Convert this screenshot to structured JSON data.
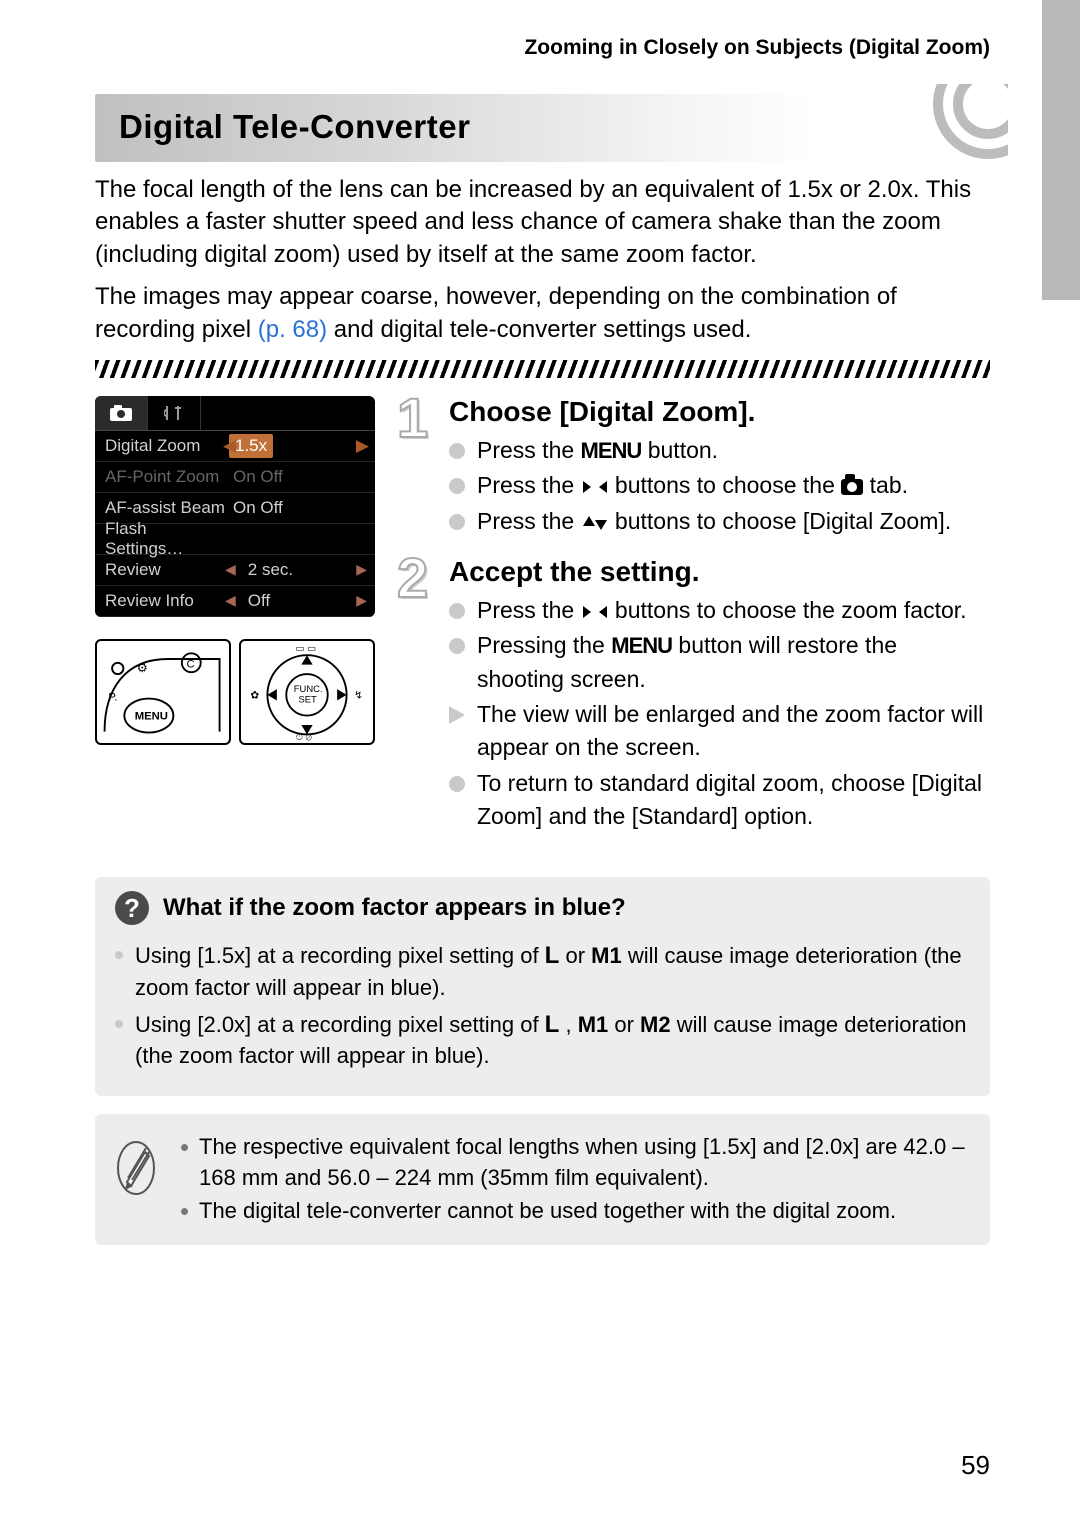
{
  "header": "Zooming in Closely on Subjects (Digital Zoom)",
  "section_title": "Digital Tele-Converter",
  "intro_1": "The focal length of the lens can be increased by an equivalent of 1.5x or 2.0x. This enables a faster shutter speed and less chance of camera shake than the zoom (including digital zoom) used by itself at the same zoom factor.",
  "intro_2a": "The images may appear coarse, however, depending on the combination of recording pixel ",
  "intro_2_link": "(p. 68)",
  "intro_2b": " and digital tele-converter settings used.",
  "menu": {
    "rows": [
      {
        "label": "Digital Zoom",
        "value": "1.5x",
        "selected": true
      },
      {
        "label": "AF-Point Zoom",
        "value": "On   Off",
        "dim": true
      },
      {
        "label": "AF-assist Beam",
        "value": "On   Off"
      },
      {
        "label": "Flash Settings…",
        "value": ""
      },
      {
        "label": "Review",
        "value": "2 sec.",
        "carets": true
      },
      {
        "label": "Review Info",
        "value": "Off",
        "carets": true
      }
    ]
  },
  "steps": [
    {
      "num": "1",
      "title": "Choose [Digital Zoom].",
      "items": [
        {
          "type": "bullet",
          "parts": [
            "Press the ",
            {
              "glyph": "MENU"
            },
            " button."
          ]
        },
        {
          "type": "bullet",
          "parts": [
            "Press the ",
            {
              "glyph": "LR"
            },
            " buttons to choose the ",
            {
              "glyph": "CAMERA"
            },
            " tab."
          ]
        },
        {
          "type": "bullet",
          "parts": [
            "Press the ",
            {
              "glyph": "UD"
            },
            " buttons to choose [Digital Zoom]."
          ]
        }
      ]
    },
    {
      "num": "2",
      "title": "Accept the setting.",
      "items": [
        {
          "type": "bullet",
          "parts": [
            "Press the ",
            {
              "glyph": "LR"
            },
            " buttons to choose the zoom factor."
          ]
        },
        {
          "type": "bullet",
          "parts": [
            "Pressing the ",
            {
              "glyph": "MENU"
            },
            " button will restore the shooting screen."
          ]
        },
        {
          "type": "result",
          "parts": [
            "The view will be enlarged and the zoom factor will appear on the screen."
          ]
        },
        {
          "type": "bullet",
          "parts": [
            "To return to standard digital zoom, choose [Digital Zoom] and the [Standard] option."
          ]
        }
      ]
    }
  ],
  "qbox": {
    "title": "What if the zoom factor appears in blue?",
    "items": [
      {
        "parts": [
          "Using [1.5x] at a recording pixel setting of  ",
          {
            "glyph": "L"
          },
          "  or ",
          {
            "glyph": "M1"
          },
          " will cause image deterioration (the zoom factor will appear in blue)."
        ]
      },
      {
        "parts": [
          "Using [2.0x] at a recording pixel setting of  ",
          {
            "glyph": "L"
          },
          " , ",
          {
            "glyph": "M1"
          },
          " or ",
          {
            "glyph": "M2"
          },
          "  will cause image deterioration (the zoom factor will appear in blue)."
        ]
      }
    ]
  },
  "notes": [
    "The respective equivalent focal lengths when using [1.5x] and [2.0x] are 42.0 – 168 mm and 56.0 – 224 mm (35mm film equivalent).",
    "The digital tele-converter cannot be used together with the digital zoom."
  ],
  "page_number": "59"
}
